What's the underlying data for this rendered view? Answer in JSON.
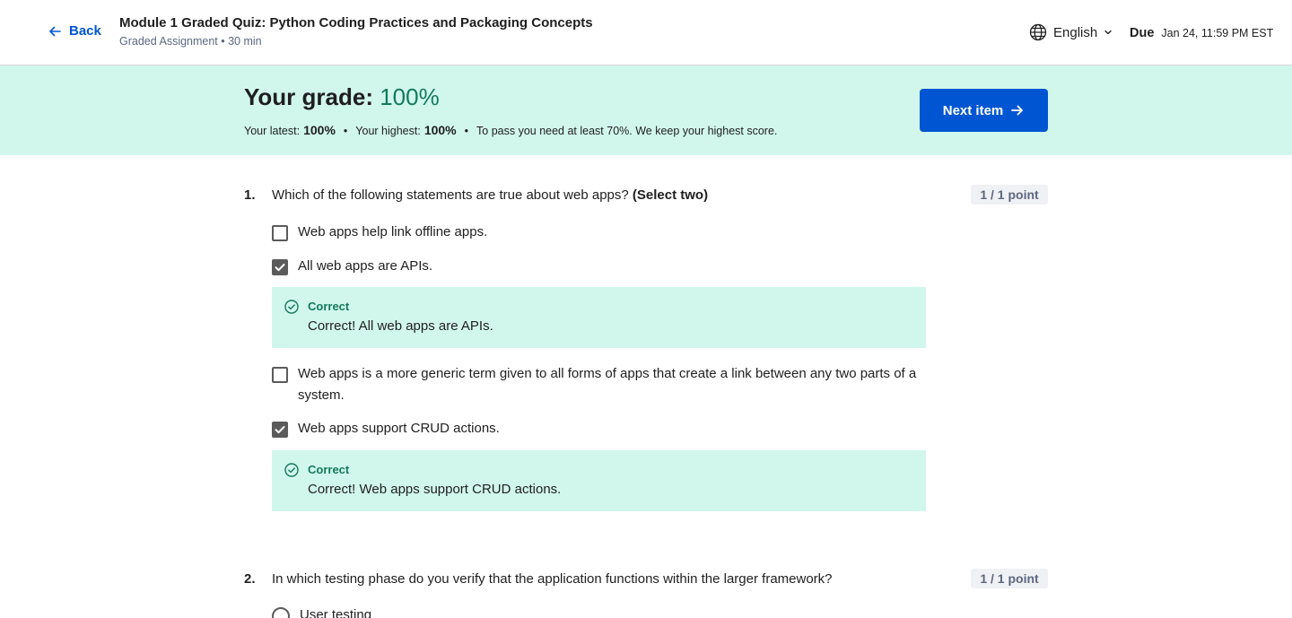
{
  "header": {
    "back_label": "Back",
    "title": "Module 1 Graded Quiz: Python Coding Practices and Packaging Concepts",
    "subtitle": "Graded Assignment • 30 min",
    "language": "English",
    "due_label": "Due",
    "due_value": "Jan 24, 11:59 PM EST"
  },
  "banner": {
    "grade_label": "Your grade:",
    "grade_value": "100%",
    "latest_label": "Your latest:",
    "latest_value": "100%",
    "highest_label": "Your highest:",
    "highest_value": "100%",
    "separator": "•",
    "pass_note": "To pass you need at least 70%. We keep your highest score.",
    "next_button": "Next item"
  },
  "questions": [
    {
      "number": "1.",
      "text": "Which of the following statements are true about web apps?",
      "instruction": "(Select two)",
      "points": "1 / 1 point",
      "options": [
        {
          "label": "Web apps help link offline apps.",
          "checked": false
        },
        {
          "label": "All web apps are APIs.",
          "checked": true,
          "feedback_title": "Correct",
          "feedback_text": "Correct! All web apps are APIs."
        },
        {
          "label": "Web apps is a more generic term given to all forms of apps that create a link between any two parts of a system.",
          "checked": false
        },
        {
          "label": "Web apps support CRUD actions.",
          "checked": true,
          "feedback_title": "Correct",
          "feedback_text": "Correct! Web apps support CRUD actions."
        }
      ]
    },
    {
      "number": "2.",
      "text": "In which testing phase do you verify that the application functions within the larger framework?",
      "points": "1 / 1 point",
      "options": [
        {
          "label": "User testing",
          "checked": false
        }
      ]
    }
  ],
  "colors": {
    "accent": "#0056d2",
    "success_bg": "#d1f7ec",
    "success_text": "#137a5b"
  },
  "icons": {
    "back": "arrow-left-icon",
    "language": "globe-icon",
    "dropdown": "chevron-down-icon",
    "next": "arrow-right-icon",
    "correct": "check-circle-icon"
  }
}
